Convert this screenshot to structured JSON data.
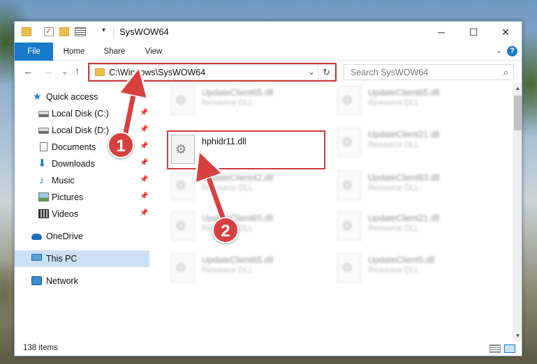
{
  "window": {
    "title": "SysWOW64",
    "minimize_icon": "minimize-icon",
    "maximize_icon": "maximize-icon",
    "close_icon": "close-icon"
  },
  "caption": {
    "minimize": "─",
    "maximize": "☐",
    "close": "✕"
  },
  "ribbon": {
    "tabs": [
      {
        "label": "File"
      },
      {
        "label": "Home"
      },
      {
        "label": "Share"
      },
      {
        "label": "View"
      }
    ],
    "help": "?"
  },
  "nav": {
    "back": "←",
    "forward": "→",
    "recent": "⌄",
    "up": "↑",
    "address": "C:\\Windows\\SysWOW64",
    "search_placeholder": "Search SysWOW64"
  },
  "navpane": {
    "items": [
      {
        "label": "Quick access",
        "icon": "star-icon"
      },
      {
        "label": "Local Disk (C:)",
        "icon": "drive-icon",
        "pinned": true
      },
      {
        "label": "Local Disk (D:)",
        "icon": "drive-icon",
        "pinned": true
      },
      {
        "label": "Documents",
        "icon": "documents-icon",
        "pinned": true
      },
      {
        "label": "Downloads",
        "icon": "downloads-icon",
        "pinned": true
      },
      {
        "label": "Music",
        "icon": "music-icon",
        "pinned": true
      },
      {
        "label": "Pictures",
        "icon": "pictures-icon",
        "pinned": true
      },
      {
        "label": "Videos",
        "icon": "videos-icon",
        "pinned": true
      },
      {
        "label": "OneDrive",
        "icon": "onedrive-icon"
      },
      {
        "label": "This PC",
        "icon": "this-pc-icon",
        "selected": true
      },
      {
        "label": "Network",
        "icon": "network-icon"
      }
    ]
  },
  "files": [
    {
      "name": "UpdateClient65.dll",
      "type": "Resource DLL"
    },
    {
      "name": "UpdateClient65.dll",
      "type": "Resource DLL"
    },
    {
      "name": "hphidr11.dll",
      "type": ""
    },
    {
      "name": "UpdateClient21.dll",
      "type": "Resource DLL"
    },
    {
      "name": "UpdateClient42.dll",
      "type": "Resource DLL"
    },
    {
      "name": "UpdateClient63.dll",
      "type": "Resource DLL"
    },
    {
      "name": "UpdateClient65.dll",
      "type": "Resource DLL"
    },
    {
      "name": "UpdateClient21.dll",
      "type": "Resource DLL"
    },
    {
      "name": "UpdateClient65.dll",
      "type": "Resource DLL"
    },
    {
      "name": "UpdateClient5.dll",
      "type": "Resource DLL"
    }
  ],
  "status": {
    "item_count": "138 items"
  },
  "annotations": {
    "marker1": "1",
    "marker2": "2"
  },
  "colors": {
    "accent": "#1979ca",
    "highlight": "#d13a3a",
    "selected": "#cce0f5"
  }
}
